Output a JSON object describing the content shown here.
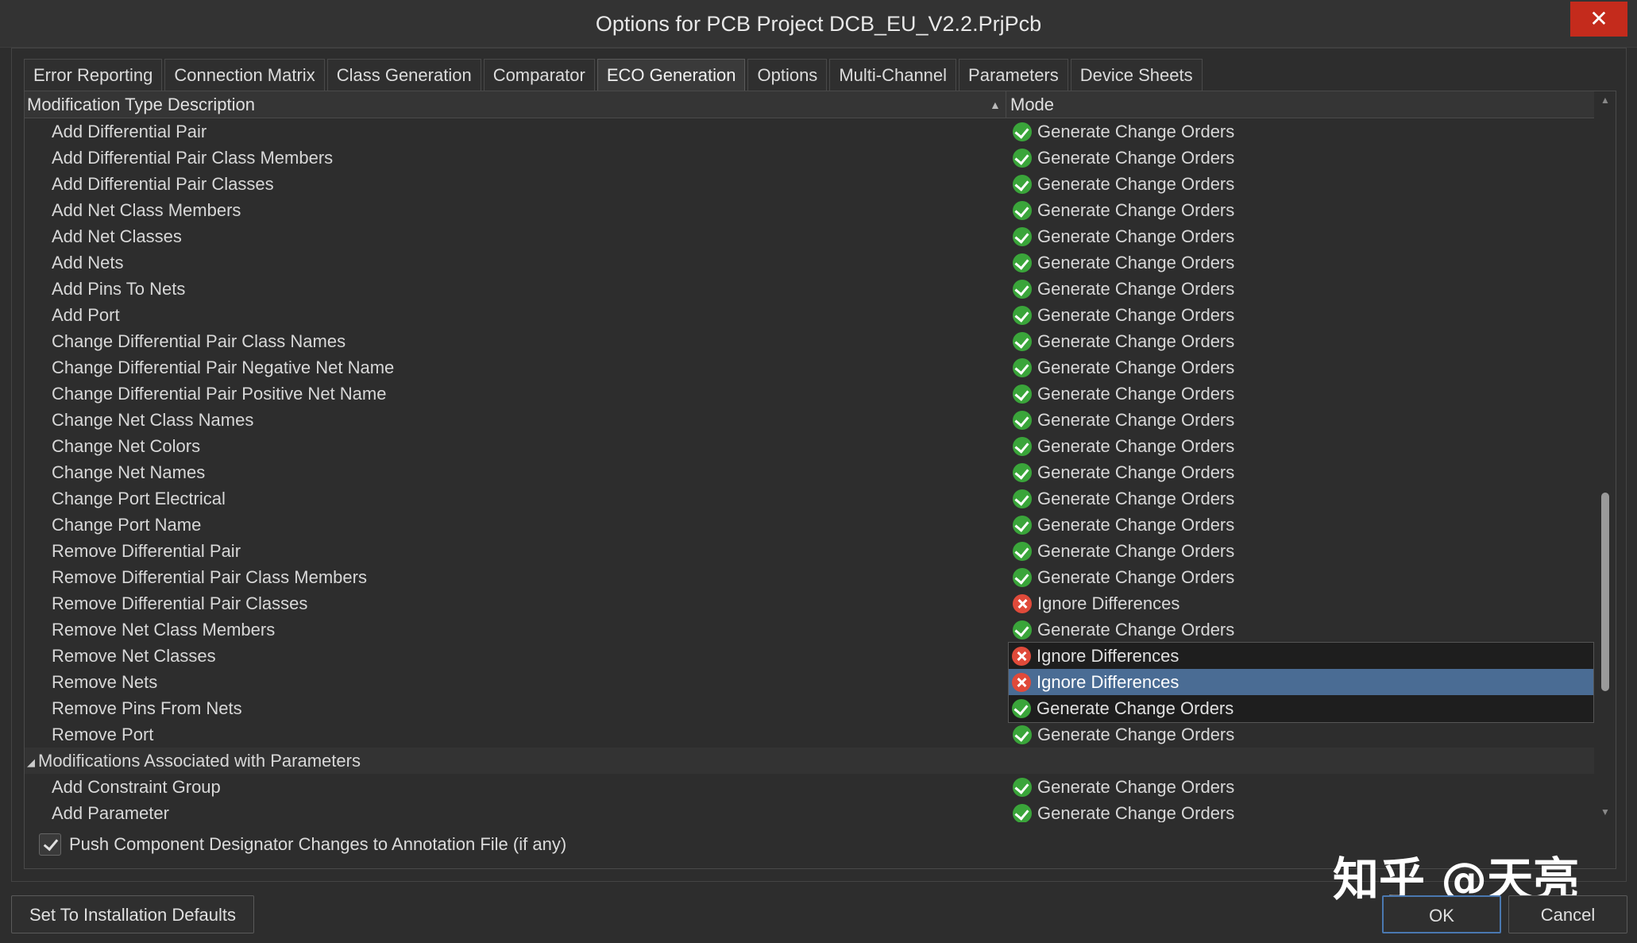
{
  "window": {
    "title": "Options for PCB Project DCB_EU_V2.2.PrjPcb",
    "close_glyph": "✕"
  },
  "tabs": [
    {
      "label": "Error Reporting"
    },
    {
      "label": "Connection Matrix"
    },
    {
      "label": "Class Generation"
    },
    {
      "label": "Comparator"
    },
    {
      "label": "ECO Generation",
      "active": true
    },
    {
      "label": "Options"
    },
    {
      "label": "Multi-Channel"
    },
    {
      "label": "Parameters"
    },
    {
      "label": "Device Sheets"
    }
  ],
  "grid": {
    "header": {
      "description": "Modification Type Description",
      "sort_glyph": "▲",
      "mode": "Mode"
    },
    "rows": [
      {
        "desc": "Add Differential Pair",
        "mode": "Generate Change Orders",
        "icon": "check-icon"
      },
      {
        "desc": "Add Differential Pair Class Members",
        "mode": "Generate Change Orders",
        "icon": "check-icon"
      },
      {
        "desc": "Add Differential Pair Classes",
        "mode": "Generate Change Orders",
        "icon": "check-icon"
      },
      {
        "desc": "Add Net Class Members",
        "mode": "Generate Change Orders",
        "icon": "check-icon"
      },
      {
        "desc": "Add Net Classes",
        "mode": "Generate Change Orders",
        "icon": "check-icon"
      },
      {
        "desc": "Add Nets",
        "mode": "Generate Change Orders",
        "icon": "check-icon"
      },
      {
        "desc": "Add Pins To Nets",
        "mode": "Generate Change Orders",
        "icon": "check-icon"
      },
      {
        "desc": "Add Port",
        "mode": "Generate Change Orders",
        "icon": "check-icon"
      },
      {
        "desc": "Change Differential Pair Class Names",
        "mode": "Generate Change Orders",
        "icon": "check-icon"
      },
      {
        "desc": "Change Differential Pair Negative Net Name",
        "mode": "Generate Change Orders",
        "icon": "check-icon"
      },
      {
        "desc": "Change Differential Pair Positive Net Name",
        "mode": "Generate Change Orders",
        "icon": "check-icon"
      },
      {
        "desc": "Change Net Class Names",
        "mode": "Generate Change Orders",
        "icon": "check-icon"
      },
      {
        "desc": "Change Net Colors",
        "mode": "Generate Change Orders",
        "icon": "check-icon"
      },
      {
        "desc": "Change Net Names",
        "mode": "Generate Change Orders",
        "icon": "check-icon"
      },
      {
        "desc": "Change Port Electrical",
        "mode": "Generate Change Orders",
        "icon": "check-icon"
      },
      {
        "desc": "Change Port Name",
        "mode": "Generate Change Orders",
        "icon": "check-icon"
      },
      {
        "desc": "Remove Differential Pair",
        "mode": "Generate Change Orders",
        "icon": "check-icon"
      },
      {
        "desc": "Remove Differential Pair Class Members",
        "mode": "Generate Change Orders",
        "icon": "check-icon"
      },
      {
        "desc": "Remove Differential Pair Classes",
        "mode": "Ignore Differences",
        "icon": "x-icon"
      },
      {
        "desc": "Remove Net Class Members",
        "mode": "Generate Change Orders",
        "icon": "check-icon"
      },
      {
        "desc": "Remove Net Classes",
        "mode": "",
        "icon": ""
      },
      {
        "desc": "Remove Nets",
        "mode": "",
        "icon": ""
      },
      {
        "desc": "Remove Pins From Nets",
        "mode": "",
        "icon": ""
      },
      {
        "desc": "Remove Port",
        "mode": "Generate Change Orders",
        "icon": "check-icon"
      },
      {
        "desc": "Modifications Associated with Parameters",
        "mode": "",
        "icon": "",
        "group": true
      },
      {
        "desc": "Add Constraint Group",
        "mode": "Generate Change Orders",
        "icon": "check-icon"
      },
      {
        "desc": "Add Parameter",
        "mode": "Generate Change Orders",
        "icon": "check-icon"
      }
    ],
    "dropdown": {
      "items": [
        {
          "label": "Ignore Differences",
          "icon": "x-icon"
        },
        {
          "label": "Ignore Differences",
          "icon": "x-icon",
          "selected": true
        },
        {
          "label": "Generate Change Orders",
          "icon": "check-icon"
        }
      ]
    }
  },
  "checkbox": {
    "label": "Push Component Designator Changes to Annotation File (if any)",
    "checked": true
  },
  "buttons": {
    "defaults": "Set To Installation Defaults",
    "ok": "OK",
    "cancel": "Cancel"
  },
  "watermark": "知乎 @天亮"
}
